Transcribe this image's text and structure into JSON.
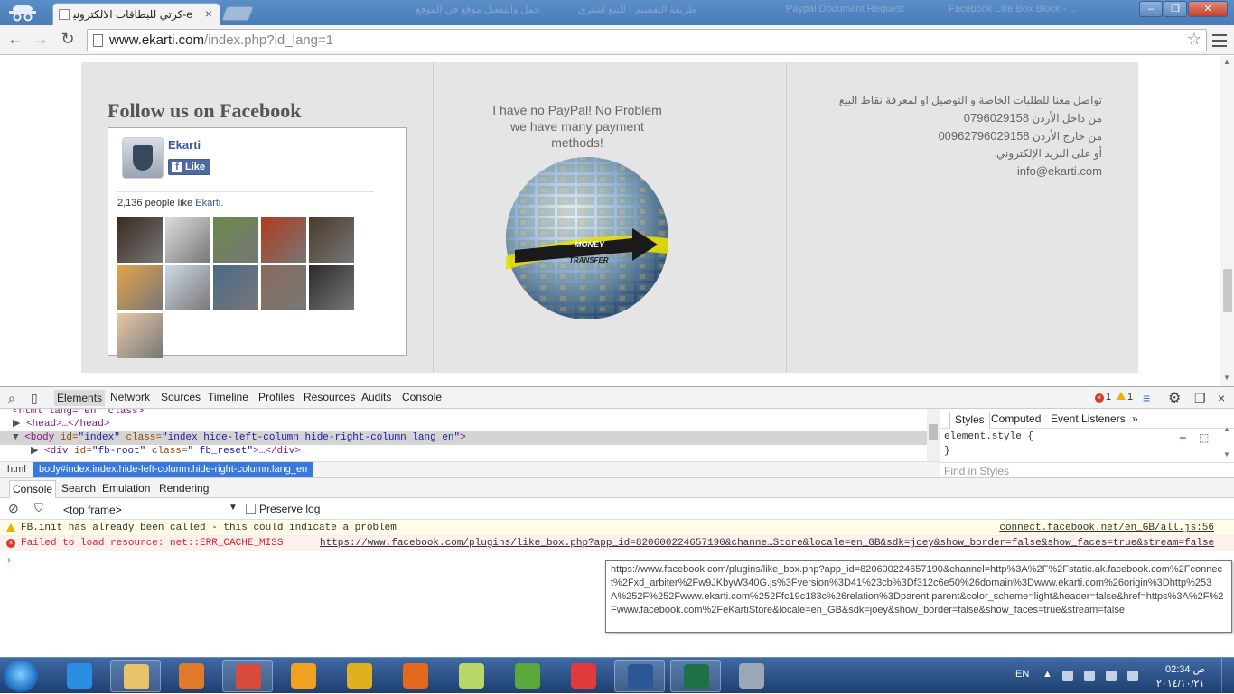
{
  "browser": {
    "active_tab_title": "e-كرتي للبطاقات الالكترونية",
    "close_symbol": "×",
    "background_tabs": [
      "حمل والتفعيل موقع في الموقع",
      "طريقة التقسيم - للبيع اشتري",
      "Paypal Document Request",
      "Facebook Like Box Block - ..."
    ],
    "window_controls": {
      "minimize": "–",
      "maximize": "❐",
      "close": "✕"
    },
    "url_host": "www.ekarti.com",
    "url_path": "/index.php?id_lang=1"
  },
  "page": {
    "facebook": {
      "heading": "Follow us on Facebook",
      "page_name": "Ekarti",
      "like_label": "Like",
      "like_count_text": "2,136 people like ",
      "like_count_link": "Ekarti.",
      "faces": [
        {
          "color": "#3a2a22"
        },
        {
          "color": "#dcdcdc"
        },
        {
          "color": "#6a8a4a"
        },
        {
          "color": "#b13b1d"
        },
        {
          "color": "#4a3a28"
        },
        {
          "color": "#e3a24a"
        },
        {
          "color": "#cfd8e6"
        },
        {
          "color": "#4a6a8a"
        },
        {
          "color": "#8a6a5a"
        },
        {
          "color": "#2a2a2a"
        },
        {
          "color": "#e8c8a8"
        }
      ]
    },
    "payment": {
      "text": "I have no PayPal! No Problem we have many payment methods!",
      "globe_label_1": "MONEY",
      "globe_label_2": "TRANSFER"
    },
    "contact": {
      "line1": "تواصل معنا للطلبات الخاصة و التوصيل او لمعرفة نقاط البيع",
      "line2_label": "من داخل الأردن",
      "line2_number": "0796029158",
      "line3_label": "من خارج الأردن",
      "line3_number": "00962796029158",
      "line4": "أو على البريد الإلكتروني",
      "email": "info@ekarti.com"
    }
  },
  "devtools": {
    "tabs": [
      "Elements",
      "Network",
      "Sources",
      "Timeline",
      "Profiles",
      "Resources",
      "Audits",
      "Console"
    ],
    "error_count": "1",
    "warning_count": "1",
    "elements": {
      "line1": "<html lang=\"en\" class>",
      "line2": "<head>…</head>",
      "body_tag": "<body",
      "body_attr1": " id=",
      "body_val1": "\"index\"",
      "body_attr2": " class=",
      "body_val2": "\"index hide-left-column hide-right-column lang_en\"",
      "body_close": ">",
      "div_tag": "<div",
      "div_attr1": " id=",
      "div_val1": "\"fb-root\"",
      "div_attr2": " class=",
      "div_val2": "\" fb_reset\"",
      "div_close": ">…</div>"
    },
    "breadcrumbs": [
      "html",
      "body#index.index.hide-left-column.hide-right-column.lang_en"
    ],
    "styles_tabs": [
      "Styles",
      "Computed",
      "Event Listeners",
      "»"
    ],
    "styles_rule_open": "element.style {",
    "styles_rule_close": "}",
    "find_placeholder": "Find in Styles",
    "drawer_tabs": [
      "Console",
      "Search",
      "Emulation",
      "Rendering"
    ],
    "frame": "<top frame>",
    "preserve_log": "Preserve log",
    "messages": [
      {
        "level": "warning",
        "text": "FB.init has already been called - this could indicate a problem",
        "source": "connect.facebook.net/en_GB/all.js:56"
      },
      {
        "level": "error",
        "text": "Failed to load resource: net::ERR_CACHE_MISS",
        "source": "https://www.facebook.com/plugins/like_box.php?app_id=820600224657190&channe…Store&locale=en_GB&sdk=joey&show_border=false&show_faces=true&stream=false"
      }
    ],
    "prompt": "›",
    "tooltip": "https://www.facebook.com/plugins/like_box.php?app_id=820600224657190&channel=http%3A%2F%2Fstatic.ak.facebook.com%2Fconnect%2Fxd_arbiter%2Fw9JKbyW340G.js%3Fversion%3D41%23cb%3Df312c6e50%26domain%3Dwww.ekarti.com%26origin%3Dhttp%253A%252F%252Fwww.ekarti.com%252Ffc19c183c%26relation%3Dparent.parent&color_scheme=light&header=false&href=https%3A%2F%2Fwww.facebook.com%2FeKartiStore&locale=en_GB&sdk=joey&show_border=false&show_faces=true&stream=false"
  },
  "taskbar": {
    "lang": "EN",
    "time": "02:34 ص",
    "date": "٢٠١٤/١٠/٢١",
    "apps": [
      {
        "name": "internet-explorer",
        "color": "#2a8fe0",
        "open": false
      },
      {
        "name": "file-explorer",
        "color": "#e8c36a",
        "open": true
      },
      {
        "name": "media-player",
        "color": "#e07a2a",
        "open": false
      },
      {
        "name": "chrome",
        "color": "#d84a3a",
        "open": true
      },
      {
        "name": "app-orange",
        "color": "#f2a020",
        "open": false
      },
      {
        "name": "app-tools",
        "color": "#e0b020",
        "open": false
      },
      {
        "name": "firefox",
        "color": "#e26a1a",
        "open": false
      },
      {
        "name": "app-folder",
        "color": "#b8d86a",
        "open": false
      },
      {
        "name": "utorrent",
        "color": "#5aa83a",
        "open": false
      },
      {
        "name": "app-red",
        "color": "#e23a3a",
        "open": false
      },
      {
        "name": "word",
        "color": "#2b5797",
        "open": true
      },
      {
        "name": "excel",
        "color": "#1e7145",
        "open": true
      },
      {
        "name": "calculator",
        "color": "#9aa8b8",
        "open": false
      }
    ]
  }
}
